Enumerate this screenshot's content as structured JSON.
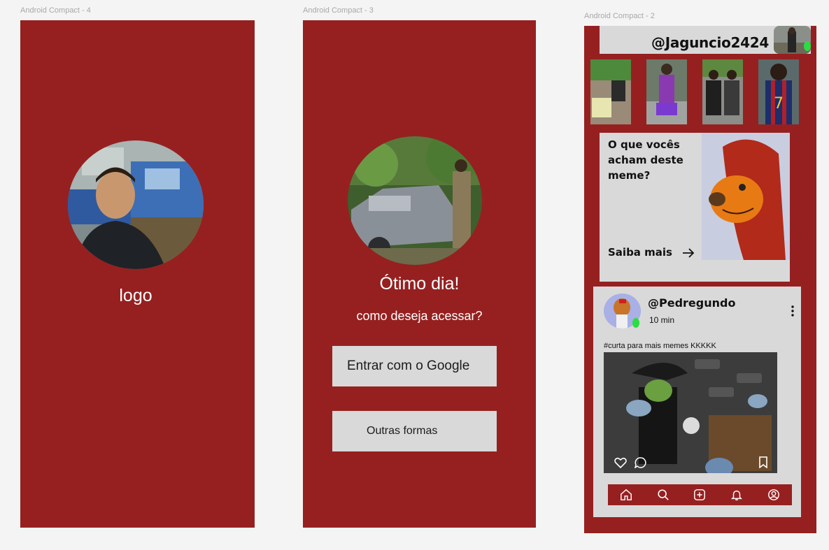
{
  "frames": {
    "splash": {
      "label": "Android Compact - 4",
      "logo_text": "logo"
    },
    "login": {
      "label": "Android Compact - 3",
      "greeting": "Ótimo dia!",
      "prompt": "como deseja acessar?",
      "google_button": "Entrar com o Google",
      "other_button": "Outras formas"
    },
    "feed": {
      "label": "Android Compact - 2",
      "current_user": "@Jaguncio2424",
      "promo_card": {
        "title": "O que vocês acham deste meme?",
        "cta": "Saiba mais"
      },
      "post": {
        "author": "@Pedregundo",
        "time": "10 min",
        "caption": "#curta para mais memes KKKKK"
      },
      "nav": [
        "home-icon",
        "search-icon",
        "add-post-icon",
        "bell-icon",
        "profile-icon"
      ]
    }
  },
  "colors": {
    "frame_bg": "#962020",
    "card_bg": "#d9d9d9",
    "canvas_bg": "#f4f4f4",
    "online": "#2bdd42"
  }
}
